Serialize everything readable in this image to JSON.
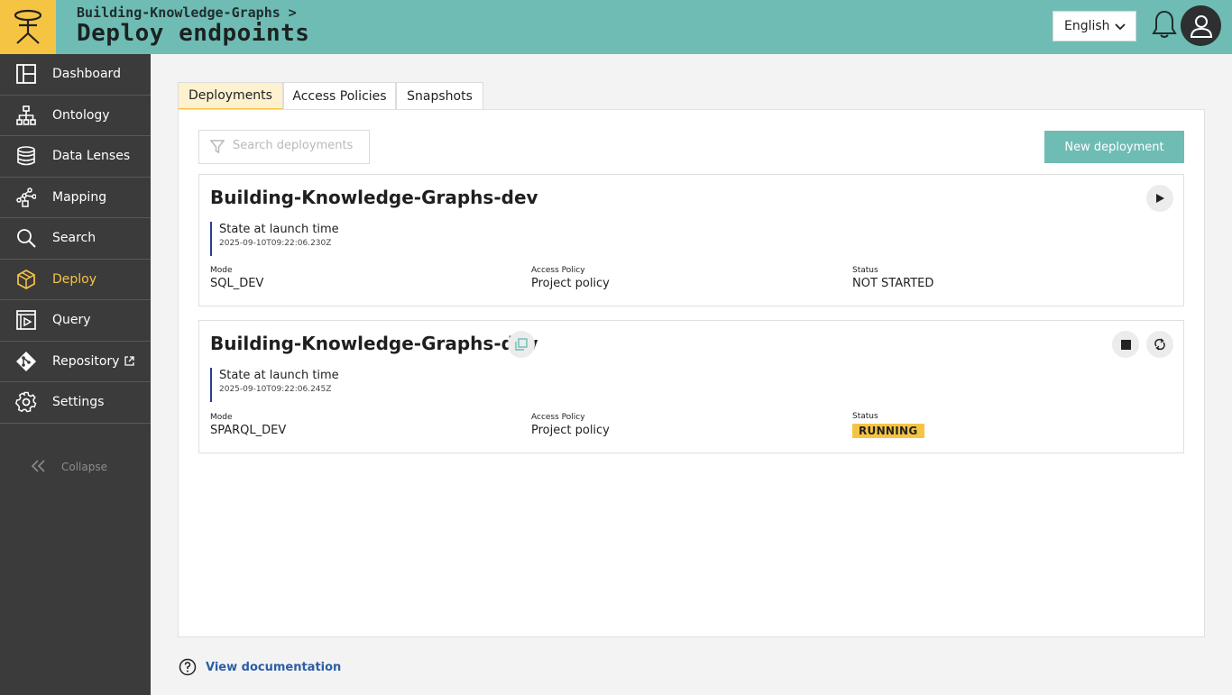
{
  "header": {
    "breadcrumb": "Building-Knowledge-Graphs >",
    "title": "Deploy endpoints",
    "language": "English"
  },
  "sidebar": {
    "items": [
      {
        "label": "Dashboard",
        "icon": "dashboard-icon"
      },
      {
        "label": "Ontology",
        "icon": "hierarchy-icon"
      },
      {
        "label": "Data Lenses",
        "icon": "database-icon"
      },
      {
        "label": "Mapping",
        "icon": "mapping-icon"
      },
      {
        "label": "Search",
        "icon": "search-icon"
      },
      {
        "label": "Deploy",
        "icon": "cube-icon",
        "active": true
      },
      {
        "label": "Query",
        "icon": "query-icon"
      },
      {
        "label": "Repository",
        "icon": "git-icon"
      },
      {
        "label": "Settings",
        "icon": "gear-icon"
      }
    ],
    "collapse_label": "Collapse"
  },
  "tabs": [
    {
      "label": "Deployments",
      "active": true
    },
    {
      "label": "Access Policies"
    },
    {
      "label": "Snapshots"
    }
  ],
  "toolbar": {
    "search_placeholder": "Search deployments",
    "new_button": "New deployment"
  },
  "deployments": [
    {
      "name": "Building-Knowledge-Graphs-dev",
      "state_label": "State at launch time",
      "state_time": "2025-09-10T09:22:06.230Z",
      "mode_label": "Mode",
      "mode": "SQL_DEV",
      "policy_label": "Access Policy",
      "policy": "Project policy",
      "status_label": "Status",
      "status": "NOT STARTED"
    },
    {
      "name": "Building-Knowledge-Graphs-dev",
      "state_label": "State at launch time",
      "state_time": "2025-09-10T09:22:06.245Z",
      "mode_label": "Mode",
      "mode": "SPARQL_DEV",
      "policy_label": "Access Policy",
      "policy": "Project policy",
      "status_label": "Status",
      "status": "RUNNING"
    }
  ],
  "footer": {
    "doc_link": "View documentation"
  },
  "colors": {
    "header": "#6fbcb5",
    "accent": "#f6c443",
    "sidebar": "#3b3b3b",
    "link": "#2b5ea6"
  }
}
